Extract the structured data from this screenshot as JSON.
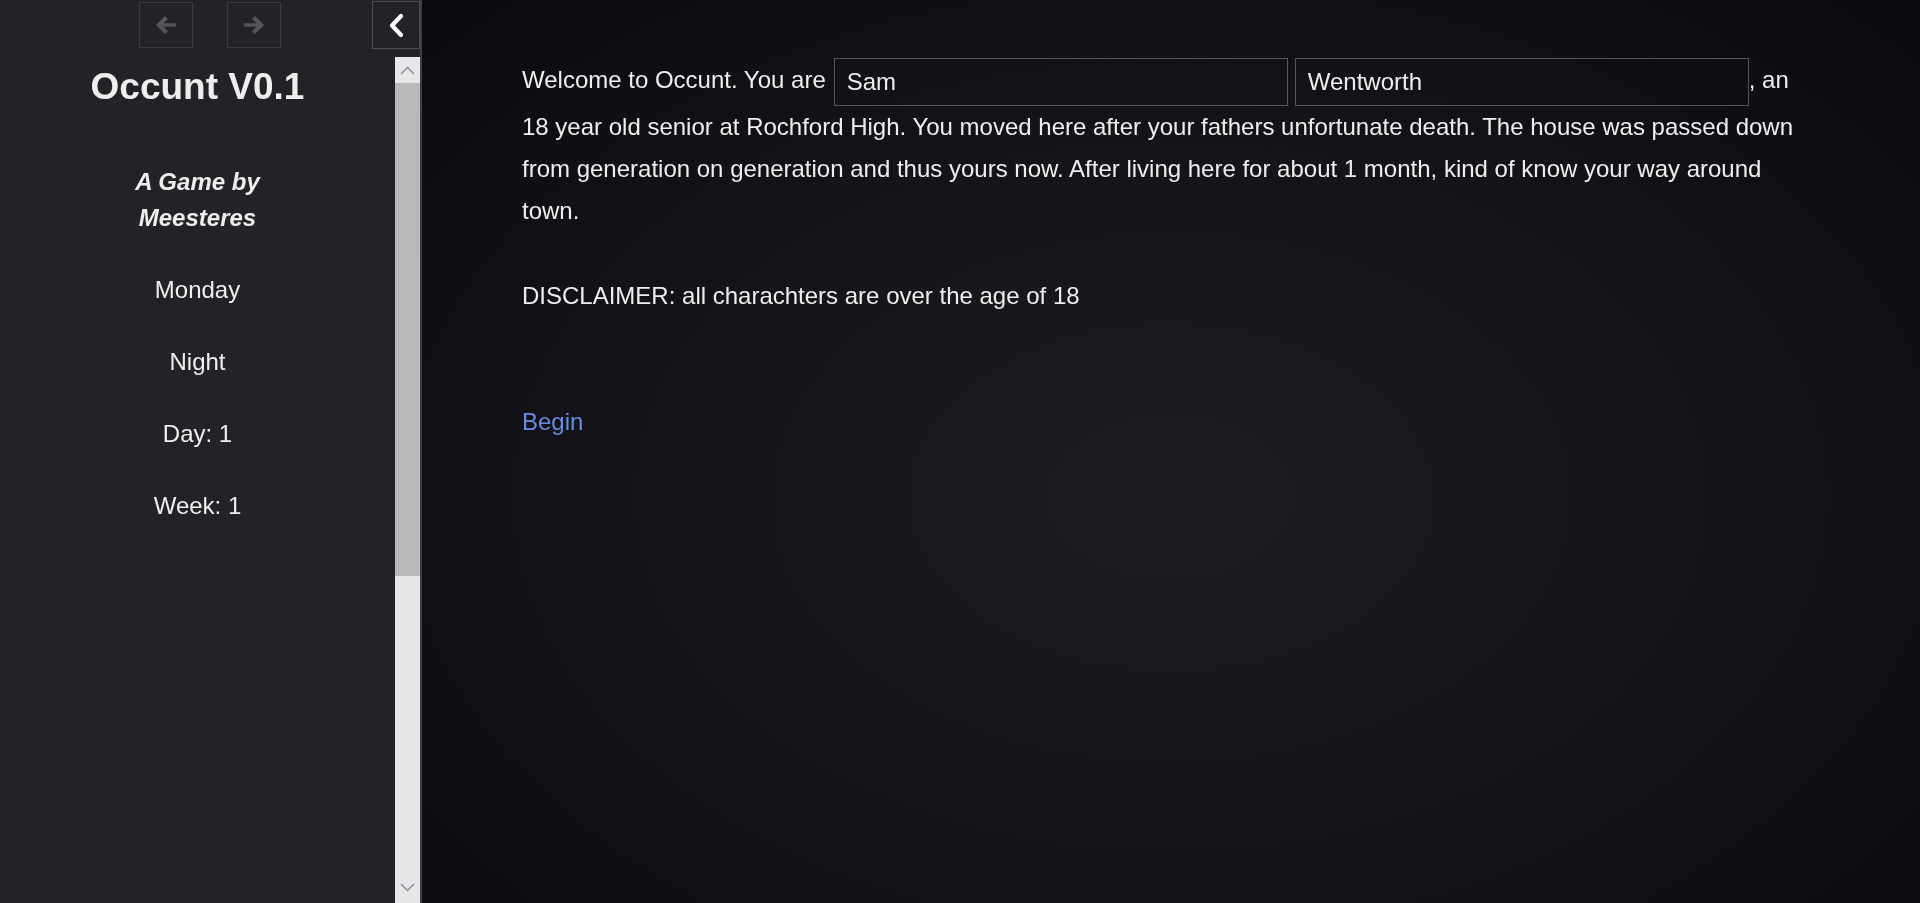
{
  "nav": {
    "back": {
      "disabled": true
    },
    "forward": {
      "disabled": true
    }
  },
  "sidebar": {
    "title": "Occunt V0.1",
    "subtitle": "A Game by Meesteres",
    "items": [
      "Monday",
      "Night",
      "Day: 1",
      "Week: 1"
    ]
  },
  "passage": {
    "text_before": "Welcome to Occunt. You are",
    "first_name": {
      "value": "Sam"
    },
    "last_name": {
      "value": "Wentworth"
    },
    "text_after": ", an",
    "text_rest": "18 year old senior at Rochford High. You moved here after your fathers unfortunate death. The house was passed down from generation on generation and thus yours now. After living here for about 1 month, kind of know your way around town.",
    "disclaimer": "DISCLAIMER: all charachters are over the age of 18",
    "link": "Begin"
  }
}
